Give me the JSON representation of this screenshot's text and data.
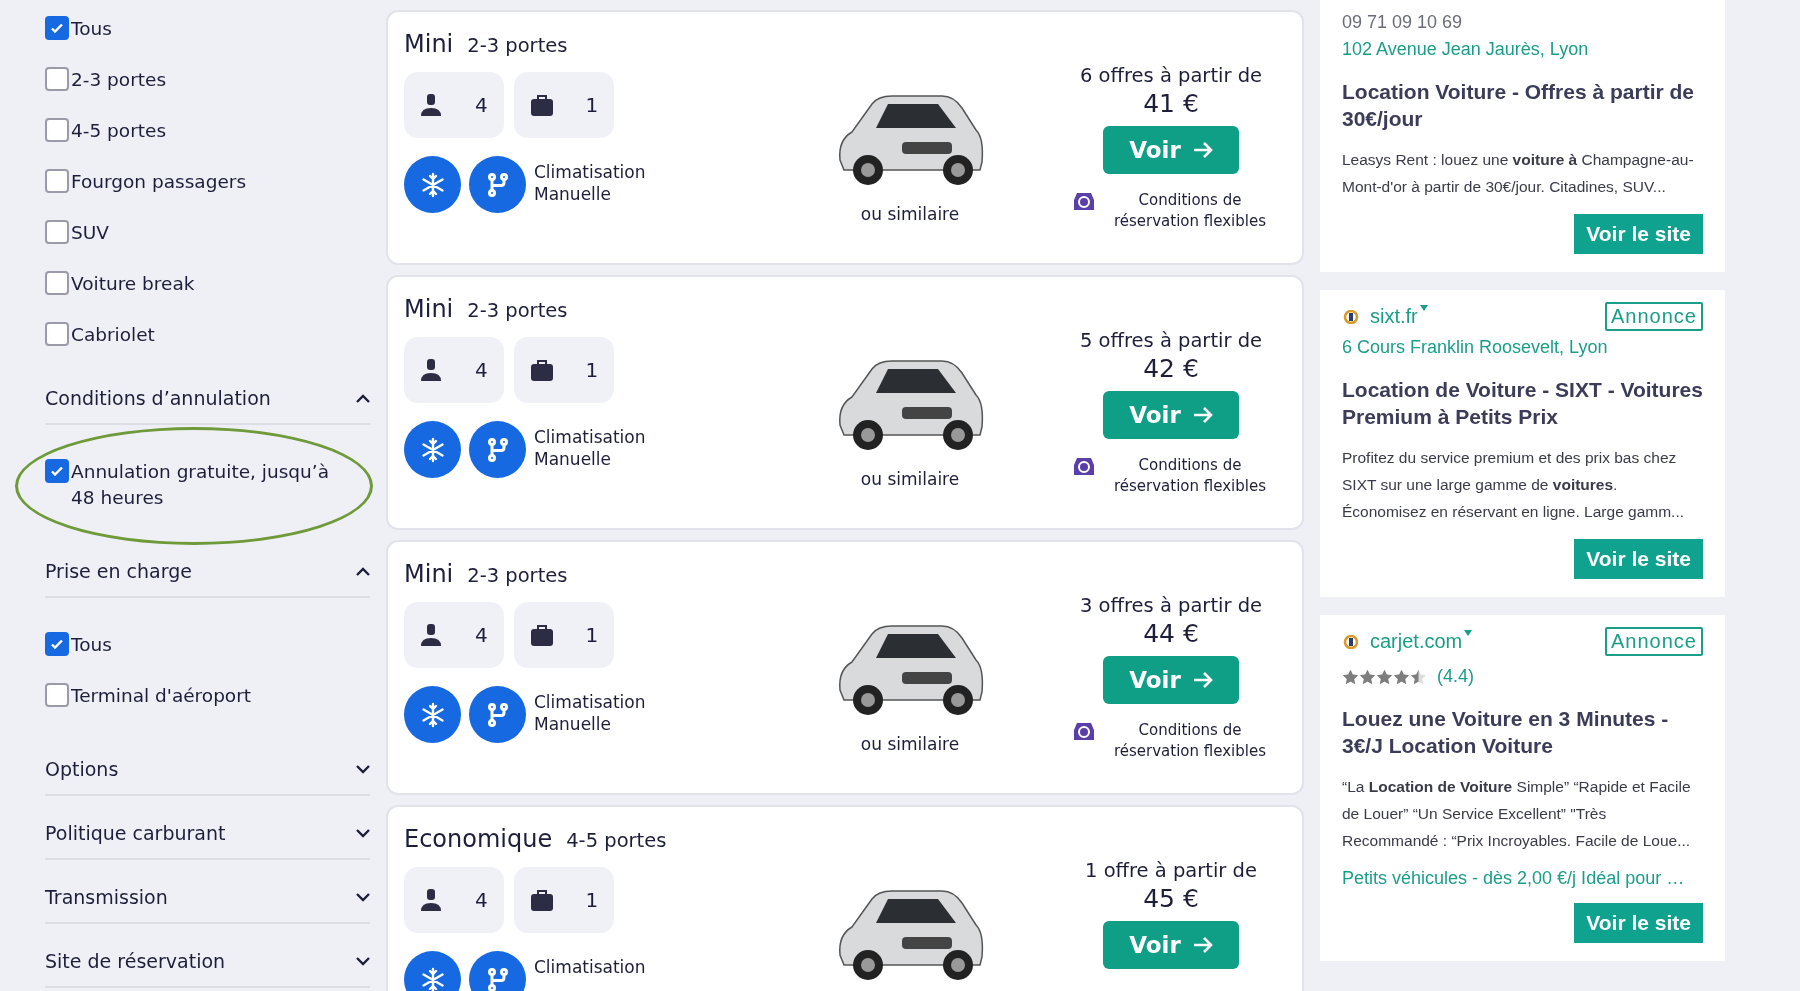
{
  "sidebar": {
    "top_options": [
      {
        "label": "Tous",
        "checked": true
      },
      {
        "label": "2-3 portes",
        "checked": false
      },
      {
        "label": "4-5 portes",
        "checked": false
      },
      {
        "label": "Fourgon passagers",
        "checked": false
      },
      {
        "label": "SUV",
        "checked": false
      },
      {
        "label": "Voiture break",
        "checked": false
      },
      {
        "label": "Cabriolet",
        "checked": false
      }
    ],
    "sections": [
      {
        "title": "Conditions d’annulation",
        "expanded": true,
        "options": [
          {
            "label": "Annulation gratuite, jusqu’à 48 heures",
            "checked": true,
            "circled": true
          }
        ]
      },
      {
        "title": "Prise en charge",
        "expanded": true,
        "options": [
          {
            "label": "Tous",
            "checked": true,
            "circled": false
          },
          {
            "label": "Terminal d'aéroport",
            "checked": false,
            "circled": false
          }
        ]
      },
      {
        "title": "Options",
        "expanded": false
      },
      {
        "title": "Politique carburant",
        "expanded": false
      },
      {
        "title": "Transmission",
        "expanded": false
      },
      {
        "title": "Site de réservation",
        "expanded": false
      }
    ]
  },
  "results": [
    {
      "category": "Mini",
      "doors": "2-3 portes",
      "seats": "4",
      "bags": "1",
      "features": [
        "Climatisation",
        "Manuelle"
      ],
      "similar": "ou similaire",
      "offers": "6 offres à partir de",
      "price": "41 €",
      "button": "Voir",
      "conditions": "Conditions de réservation flexibles"
    },
    {
      "category": "Mini",
      "doors": "2-3 portes",
      "seats": "4",
      "bags": "1",
      "features": [
        "Climatisation",
        "Manuelle"
      ],
      "similar": "ou similaire",
      "offers": "5 offres à partir de",
      "price": "42 €",
      "button": "Voir",
      "conditions": "Conditions de réservation flexibles"
    },
    {
      "category": "Mini",
      "doors": "2-3 portes",
      "seats": "4",
      "bags": "1",
      "features": [
        "Climatisation",
        "Manuelle"
      ],
      "similar": "ou similaire",
      "offers": "3 offres à partir de",
      "price": "44 €",
      "button": "Voir",
      "conditions": "Conditions de réservation flexibles"
    },
    {
      "category": "Economique",
      "doors": "4-5 portes",
      "seats": "4",
      "bags": "1",
      "features": [
        "Climatisation"
      ],
      "offers": "1 offre à partir de",
      "price": "45 €",
      "button": "Voir"
    }
  ],
  "ads": [
    {
      "phone": "09 71 09 10 69",
      "address": "102 Avenue Jean Jaurès, Lyon",
      "title": "Location Voiture - Offres à partir de 30€/jour",
      "description": "Leasys Rent : louez une **voiture à** Champagne-au-Mont-d'or à partir de 30€/jour. Citadines, SUV...",
      "button": "Voir le site"
    },
    {
      "site": "sixt.fr",
      "badge": "Annonce",
      "address": "6 Cours Franklin Roosevelt, Lyon",
      "title": "Location de Voiture - SIXT - Voitures Premium à Petits Prix",
      "description": "Profitez du service premium et des prix bas chez SIXT sur une large gamme de **voitures**. Économisez en réservant en ligne. Large gamm...",
      "button": "Voir le site"
    },
    {
      "site": "carjet.com",
      "badge": "Annonce",
      "stars": 4.5,
      "rating": "(4.4)",
      "title": "Louez une Voiture en 3 Minutes - 3€/J Location Voiture",
      "description": "“La **Location de Voiture** Simple” “Rapide et Facile de Louer” “Un Service Excellent” \"Très Recommandé : “Prix Incroyables. Facile de Loue...",
      "link": "Petits véhicules - dès 2,00 €/j Idéal pour …",
      "button": "Voir le site"
    }
  ]
}
